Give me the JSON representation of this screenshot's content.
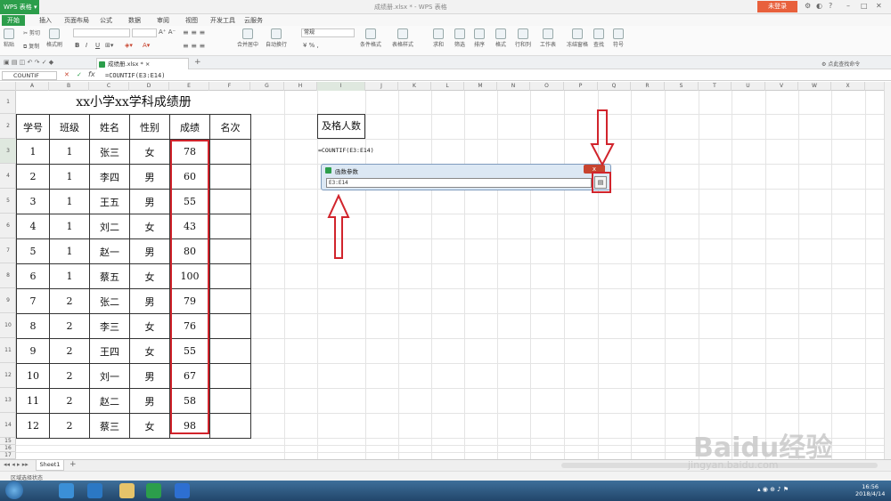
{
  "app": {
    "name": "WPS 表格",
    "doc_title": "成绩册.xlsx * - WPS 表格",
    "login": "未登录"
  },
  "menu": [
    "开始",
    "插入",
    "页面布局",
    "公式",
    "数据",
    "审阅",
    "视图",
    "开发工具",
    "云服务"
  ],
  "ribbon": {
    "paste": "粘贴",
    "cut": "剪切",
    "copy": "复制",
    "format_painter": "格式刷",
    "number_format": "常规",
    "merge": "合并居中",
    "wrap": "自动换行",
    "cond_format": "条件格式",
    "table_style": "表格样式",
    "sum": "求和",
    "filter": "筛选",
    "sort": "排序",
    "format": "格式",
    "row_col": "行和列",
    "worksheet": "工作表",
    "freeze": "冻结窗格",
    "find": "查找",
    "symbol": "符号"
  },
  "file_tab": "成绩册.xlsx *",
  "find_cmd": "点此查找命令",
  "formula_bar": {
    "name_box": "COUNTIF",
    "formula": "=COUNTIF(E3:E14)"
  },
  "columns": [
    "A",
    "B",
    "C",
    "D",
    "E",
    "F",
    "G",
    "H",
    "I",
    "J",
    "K",
    "L",
    "M",
    "N",
    "O",
    "P",
    "Q",
    "R",
    "S",
    "T",
    "U",
    "V",
    "W",
    "X"
  ],
  "rows": [
    "1",
    "2",
    "3",
    "4",
    "5",
    "6",
    "7",
    "8",
    "9",
    "10",
    "11",
    "12",
    "13",
    "14",
    "15",
    "16",
    "17"
  ],
  "sheet": {
    "title": "xx小学xx学科成绩册",
    "headers": [
      "学号",
      "班级",
      "姓名",
      "性别",
      "成绩",
      "名次"
    ],
    "records": [
      [
        "1",
        "1",
        "张三",
        "女",
        "78",
        ""
      ],
      [
        "2",
        "1",
        "李四",
        "男",
        "60",
        ""
      ],
      [
        "3",
        "1",
        "王五",
        "男",
        "55",
        ""
      ],
      [
        "4",
        "1",
        "刘二",
        "女",
        "43",
        ""
      ],
      [
        "5",
        "1",
        "赵一",
        "男",
        "80",
        ""
      ],
      [
        "6",
        "1",
        "蔡五",
        "女",
        "100",
        ""
      ],
      [
        "7",
        "2",
        "张二",
        "男",
        "79",
        ""
      ],
      [
        "8",
        "2",
        "李三",
        "女",
        "76",
        ""
      ],
      [
        "9",
        "2",
        "王四",
        "女",
        "55",
        ""
      ],
      [
        "10",
        "2",
        "刘一",
        "男",
        "67",
        ""
      ],
      [
        "11",
        "2",
        "赵二",
        "男",
        "58",
        ""
      ],
      [
        "12",
        "2",
        "蔡三",
        "女",
        "98",
        ""
      ]
    ],
    "pass_label": "及格人数",
    "pass_formula": "=COUNTIF(E3:E14)"
  },
  "dialog": {
    "title": "函数参数",
    "close": "x",
    "input_value": "E3:E14"
  },
  "sheet_tab": "Sheet1",
  "status": "区域选择状态",
  "clock": {
    "time": "16:56",
    "date": "2018/4/14"
  },
  "watermark": {
    "brand": "Baidu经验",
    "url": "jingyan.baidu.com"
  },
  "colors": {
    "accent": "#2c9e4b",
    "highlight": "#d1242c",
    "login": "#e8603c"
  }
}
